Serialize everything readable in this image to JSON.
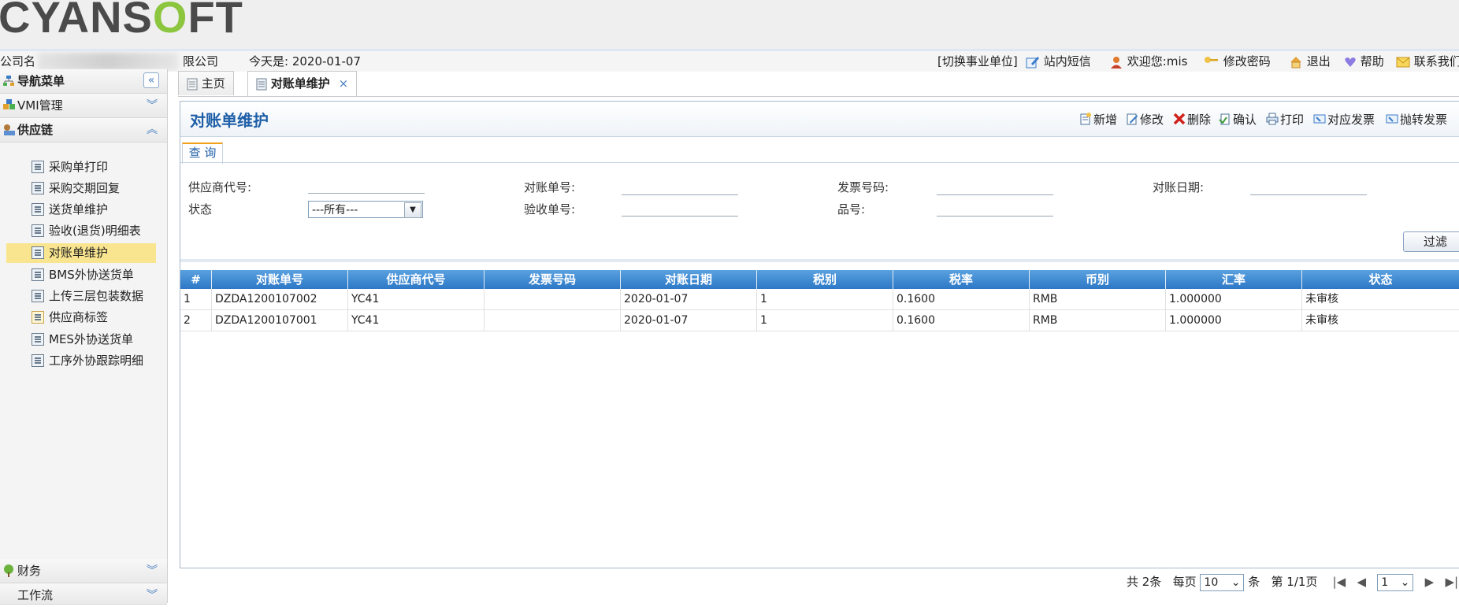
{
  "header": {
    "logo_main": "CYANS",
    "logo_o": "O",
    "logo_end": "FT",
    "company_prefix": "公司名",
    "company_suffix": "限公司",
    "today": "今天是: 2020-01-07",
    "switch_unit": "[切换事业单位]",
    "messages": "站内短信",
    "welcome": "欢迎您:mis",
    "change_password": "修改密码",
    "logout": "退出",
    "help": "帮助",
    "contact": "联系我们"
  },
  "sidebar": {
    "nav_title": "导航菜单",
    "vmi": "VMI管理",
    "supply_chain": "供应链",
    "items": [
      {
        "label": "采购单打印"
      },
      {
        "label": "采购交期回复"
      },
      {
        "label": "送货单维护"
      },
      {
        "label": "验收(退货)明细表"
      },
      {
        "label": "对账单维护"
      },
      {
        "label": "BMS外协送货单"
      },
      {
        "label": "上传三层包装数据"
      },
      {
        "label": "供应商标签"
      },
      {
        "label": "MES外协送货单"
      },
      {
        "label": "工序外协跟踪明细"
      }
    ],
    "finance": "财务",
    "workflow": "工作流"
  },
  "tabs": {
    "home": "主页",
    "current": "对账单维护",
    "close": "×"
  },
  "panel": {
    "title": "对账单维护",
    "toolbar": {
      "add": "新增",
      "edit": "修改",
      "delete": "删除",
      "confirm": "确认",
      "print": "打印",
      "match_invoice": "对应发票",
      "transfer_invoice": "抛转发票"
    },
    "query_tab": "查 询",
    "query": {
      "supplier_code": "供应商代号:",
      "status": "状态",
      "status_value": "---所有---",
      "statement_no": "对账单号:",
      "receipt_no": "验收单号:",
      "invoice_no": "发票号码:",
      "part_no": "品号:",
      "statement_date": "对账日期:"
    },
    "filter_button": "过滤"
  },
  "grid": {
    "headers": [
      "#",
      "对账单号",
      "供应商代号",
      "发票号码",
      "对账日期",
      "税别",
      "税率",
      "币别",
      "汇率",
      "状态"
    ],
    "rows": [
      [
        "1",
        "DZDA1200107002",
        "YC41",
        "",
        "2020-01-07",
        "1",
        "0.1600",
        "RMB",
        "1.000000",
        "未审核"
      ],
      [
        "2",
        "DZDA1200107001",
        "YC41",
        "",
        "2020-01-07",
        "1",
        "0.1600",
        "RMB",
        "1.000000",
        "未审核"
      ]
    ]
  },
  "pager": {
    "total": "共 2条",
    "per_page_label": "每页",
    "per_page": "10",
    "unit": "条",
    "page_info": "第 1/1页",
    "page_select": "1"
  },
  "colors": {
    "header_blue": "#2d78c6",
    "title_blue": "#1f5fa8",
    "selected_item": "#f9e58f",
    "logo_green": "#8cc63f"
  }
}
